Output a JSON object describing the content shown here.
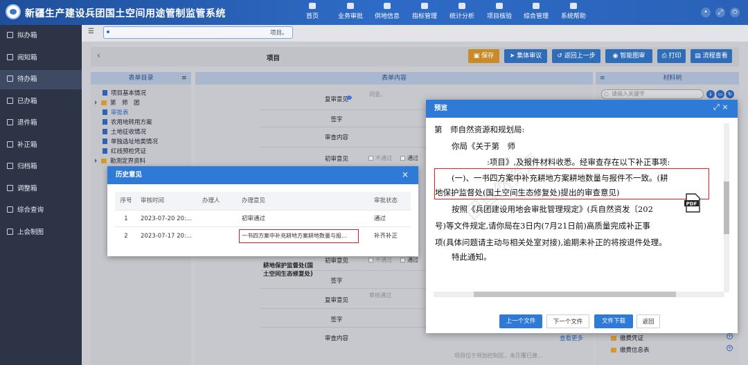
{
  "app": {
    "title": "新疆生产建设兵团国土空间用途管制监管系统"
  },
  "nav": [
    "首页",
    "业务审批",
    "供地信息",
    "指标管理",
    "统计分析",
    "项目核验",
    "综合管理",
    "系统帮助"
  ],
  "sidebar": [
    "拟办箱",
    "阅知箱",
    "待办箱",
    "已办箱",
    "退件箱",
    "补正箱",
    "归档箱",
    "调整箱",
    "综合查询",
    "上会制图"
  ],
  "tab": {
    "label": "项目。"
  },
  "toolbar": {
    "title": "项目",
    "save": "保存",
    "collective": "集体审议",
    "back": "返回上一步",
    "smart": "智能图审",
    "print": "打印",
    "flow": "流程查看"
  },
  "left_panel": {
    "header": "表单目录",
    "items": [
      "项目基本情况",
      "第　师　团",
      "审批表",
      "农用地转用方案",
      "土地征收情况",
      "单独选址地类情况",
      "红线预检凭证",
      "勘测定界资料"
    ]
  },
  "center_panel": {
    "header": "表单内容",
    "rows": [
      "复审意见",
      "签字",
      "审查内容",
      "初审意见",
      "初审意见",
      "签字",
      "复审意见",
      "签字",
      "审查内容"
    ],
    "org": "耕地保护监督处(国土空间生态修复处)",
    "no_pass": "不通过",
    "pass": "通过",
    "recheck_placeholder": "同意。",
    "recheck_pass": "审核通过",
    "more": "查看更多",
    "footer_note": "项目位于规划控制区，未压覆已建..."
  },
  "right_panel": {
    "header": "材料树",
    "search_placeholder": "请输入关键字",
    "items": [
      "缴费凭证",
      "缴费信息表"
    ]
  },
  "history": {
    "title": "历史意见",
    "columns": [
      "序号",
      "审核时间",
      "办理人",
      "办理意见",
      "审批状态"
    ],
    "rows": [
      {
        "no": "1",
        "time": "2023-07-20 20:...",
        "handler": "",
        "opinion": "初审通过",
        "status": "通过"
      },
      {
        "no": "2",
        "time": "2023-07-17 20:...",
        "handler": "",
        "opinion": "一书四方案中补充耕地方案耕地数量与报...",
        "status": "补齐补正"
      }
    ]
  },
  "preview": {
    "title": "预览",
    "lines": [
      "第　师自然资源和规划局:",
      "你局《关于第　师",
      ":项目》,及报件材料收悉。经审查存在以下补正事项:",
      "(一)、一书四方案中补充耕地方案耕地数量与报件不一致。(耕",
      "地保护监督处(国土空间生态修复处)提出的审查意见)",
      "按照《兵团建设用地会审批管理规定》(兵自然资发〔202",
      "号)等文件规定,请你局在3日内(7月21日前)高质量完成补正事",
      "项(具体问题请主动与相关处室对接),逾期未补正的将按退件处理。",
      "特此通知。"
    ],
    "pdf_label": "PDF",
    "watermark": "团自然资源",
    "buttons": [
      "上一个文件",
      "下一个文件",
      "文件下载",
      "返回"
    ]
  }
}
